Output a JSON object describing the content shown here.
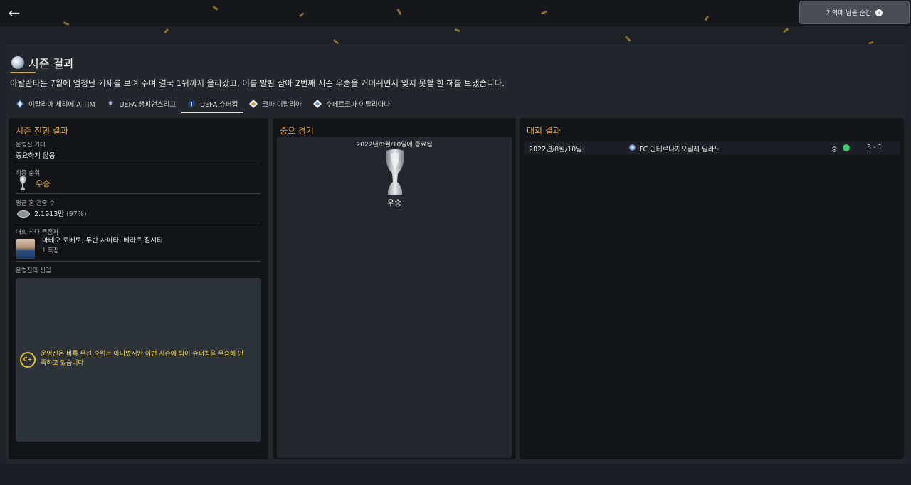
{
  "header": {
    "back_icon": "back-arrow-icon",
    "continue_label": "기억에 남을 순간",
    "continue_icon": "arrow-right-circle-icon"
  },
  "season": {
    "title": "시즌 결과",
    "summary": "아탈란타는 7월에 엄청난 기세를 보여 주며 결국 1위까지 올라갔고, 이를 발판 삼아 2번째 시즌 우승을 거머쥐면서 잊지 못할 한 해를 보냈습니다."
  },
  "tabs": [
    {
      "label": "이탈리아 세리에 A TIM",
      "icon": "serie-a-icon"
    },
    {
      "label": "UEFA 챔피언스리그",
      "icon": "champions-league-icon"
    },
    {
      "label": "UEFA 슈퍼컵",
      "icon": "super-cup-icon",
      "active": true
    },
    {
      "label": "코파 이탈리아",
      "icon": "coppa-italia-icon"
    },
    {
      "label": "수페르코파 이탈리아나",
      "icon": "supercoppa-icon"
    }
  ],
  "season_progress": {
    "title": "시즌 진행 결과",
    "board_expectation_label": "운영진 기대",
    "board_expectation_value": "중요하지 않음",
    "final_position_label": "최종 순위",
    "final_position_value": "우승",
    "avg_attendance_label": "평균 홈 관중 수",
    "avg_attendance_value": "2.1913만",
    "avg_attendance_pct": "(97%)",
    "top_scorer_label": "대회 최다 득점자",
    "top_scorer_names": "마테오 로베토, 두반 사파타, 베라트 짐시티",
    "top_scorer_goals": "1 득점",
    "board_confidence_label": "운영진의 신임",
    "board_grade": "C+",
    "board_confidence_text": "운영진은 비록 우선 순위는 아니었지만 이번 시즌에 팀이 슈퍼컵을 우승해 만족하고 있습니다."
  },
  "key_match": {
    "title": "중요 경기",
    "date": "2022년/8월/10일에 종료됨",
    "result": "우승"
  },
  "competition_results": {
    "title": "대회 결과",
    "rows": [
      {
        "date": "2022년/8월/10일",
        "opponent": "FC 인테르나치오날레 밀라노",
        "venue": "중",
        "score": "3 - 1",
        "outcome": "win"
      }
    ]
  },
  "colors": {
    "accent_gold": "#d9a548",
    "win_green": "#3dc46a",
    "grade_yellow": "#e3c21c"
  }
}
